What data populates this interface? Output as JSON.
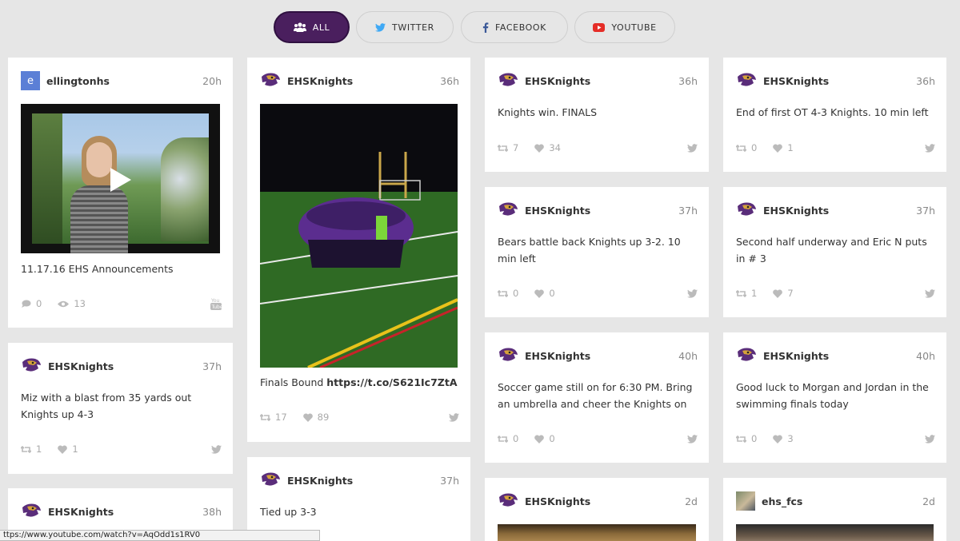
{
  "filters": [
    {
      "label": "ALL",
      "icon": "people-icon"
    },
    {
      "label": "TWITTER",
      "icon": "twitter-icon"
    },
    {
      "label": "FACEBOOK",
      "icon": "facebook-icon"
    },
    {
      "label": "YOUTUBE",
      "icon": "youtube-icon"
    }
  ],
  "colors": {
    "accent": "#4a1f5e",
    "twitter": "#3fa9f5",
    "facebook": "#3b5998",
    "youtube": "#e52d27"
  },
  "posts": [
    {
      "user": "ellingtonhs",
      "avatar_letter": "e",
      "time": "20h",
      "text": "11.17.16 EHS Announcements",
      "stat1": "0",
      "stat2": "13",
      "network": "youtube"
    },
    {
      "user": "EHSKnights",
      "time": "37h",
      "text": "Miz with a blast from 35 yards out Knights up 4-3",
      "retweets": "1",
      "likes": "1",
      "network": "twitter"
    },
    {
      "user": "EHSKnights",
      "time": "38h"
    },
    {
      "user": "EHSKnights",
      "time": "36h",
      "text": "Finals Bound ",
      "link": "https://t.co/S621Ic7ZtA",
      "retweets": "17",
      "likes": "89",
      "network": "twitter"
    },
    {
      "user": "EHSKnights",
      "time": "37h",
      "text": "Tied up 3-3"
    },
    {
      "user": "EHSKnights",
      "time": "36h",
      "text": "Knights win. FINALS",
      "retweets": "7",
      "likes": "34",
      "network": "twitter"
    },
    {
      "user": "EHSKnights",
      "time": "37h",
      "text": "Bears battle back Knights up 3-2. 10 min left",
      "retweets": "0",
      "likes": "0",
      "network": "twitter"
    },
    {
      "user": "EHSKnights",
      "time": "40h",
      "text": "Soccer game still on for 6:30 PM. Bring an umbrella and cheer the Knights on",
      "retweets": "0",
      "likes": "0",
      "network": "twitter"
    },
    {
      "user": "EHSKnights",
      "time": "2d"
    },
    {
      "user": "EHSKnights",
      "time": "36h",
      "text": "End of first OT 4-3 Knights. 10 min left",
      "retweets": "0",
      "likes": "1",
      "network": "twitter"
    },
    {
      "user": "EHSKnights",
      "time": "37h",
      "text": "Second half underway and Eric N puts in # 3",
      "retweets": "1",
      "likes": "7",
      "network": "twitter"
    },
    {
      "user": "EHSKnights",
      "time": "40h",
      "text": "Good luck to Morgan and Jordan in the swimming finals today",
      "retweets": "0",
      "likes": "3",
      "network": "twitter"
    },
    {
      "user": "ehs_fcs",
      "time": "2d"
    }
  ],
  "statusbar": {
    "url": "ttps://www.youtube.com/watch?v=AqOdd1s1RV0"
  }
}
